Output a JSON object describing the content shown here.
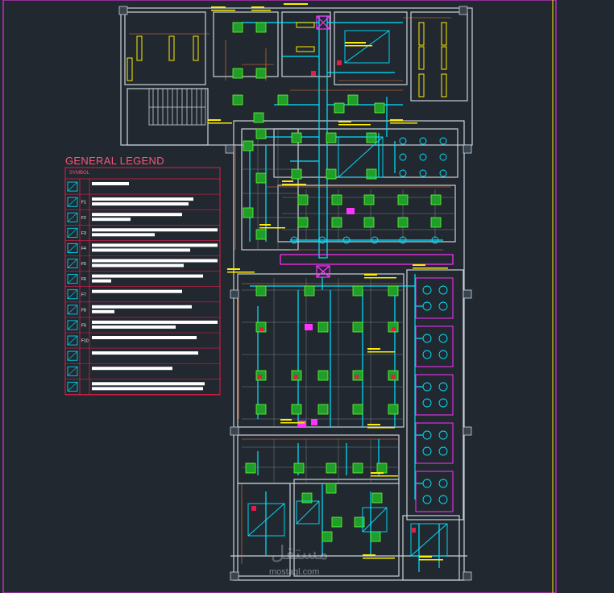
{
  "legend": {
    "title": "GENERAL LEGEND",
    "header_label": "SYMBOL",
    "rows": [
      {
        "code": "",
        "icon": "diffuser-icon",
        "bars": [
          46
        ]
      },
      {
        "code": "F1",
        "icon": "fan-icon",
        "bars": [
          126,
          120
        ]
      },
      {
        "code": "F2",
        "icon": "fan-icon",
        "bars": [
          112,
          48
        ]
      },
      {
        "code": "F3",
        "icon": "damper-icon",
        "bars": [
          158,
          78
        ]
      },
      {
        "code": "F4",
        "icon": "grille-icon",
        "bars": [
          158,
          122
        ]
      },
      {
        "code": "F5",
        "icon": "round-diffuser-icon",
        "bars": [
          160,
          114
        ]
      },
      {
        "code": "F6",
        "icon": "round-diffuser-icon",
        "bars": [
          138,
          24
        ]
      },
      {
        "code": "F7",
        "icon": "linear-diffuser-icon",
        "bars": [
          112
        ]
      },
      {
        "code": "F8",
        "icon": "valve-icon",
        "bars": [
          124,
          28
        ]
      },
      {
        "code": "F9",
        "icon": "valve-icon",
        "bars": [
          156,
          104
        ]
      },
      {
        "code": "F10",
        "icon": "grille-icon",
        "bars": [
          130
        ]
      },
      {
        "code": "",
        "icon": "thermostat-icon",
        "bars": [
          132
        ]
      },
      {
        "code": "",
        "icon": "sensor-icon",
        "bars": [
          100
        ]
      },
      {
        "code": "",
        "icon": "fire-damper-icon",
        "bars": [
          140,
          138
        ]
      }
    ]
  },
  "drawing_labels": {
    "top_dims": [
      "1480",
      "1480",
      "1190"
    ],
    "room_labels": [
      "-",
      "-",
      "-"
    ],
    "dims": [
      "1190",
      "1310",
      "1370",
      "1190",
      "1480",
      "1300",
      "1300",
      "1460",
      "1190",
      "1370",
      "1190",
      "1440",
      "1860",
      "1140",
      "1350",
      "1510"
    ]
  },
  "watermark": {
    "text": "mostaql.com",
    "arabic": "مستقل"
  },
  "colors": {
    "background": "#212830",
    "wall": "#c9d1d9",
    "duct": "#00e5ff",
    "diffuser": "#66ff33",
    "dimension": "#ff7b2e",
    "text": "#ffee00",
    "magenta": "#ff33ff",
    "legend_red": "#e11d48"
  }
}
